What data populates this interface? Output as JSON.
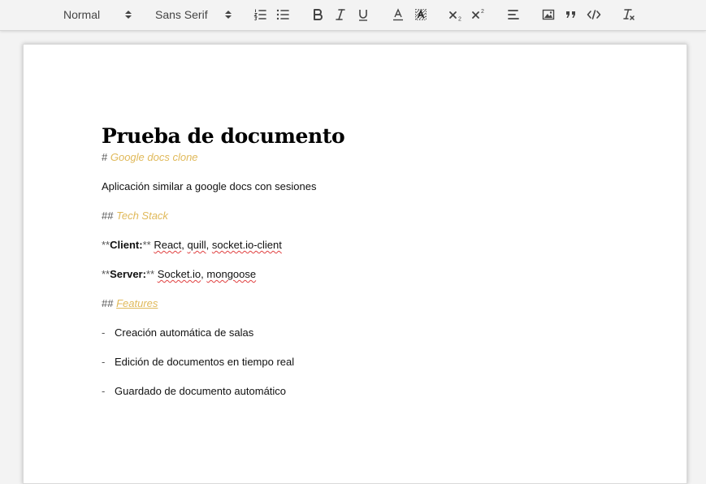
{
  "toolbar": {
    "header_select": "Normal",
    "font_select": "Sans Serif",
    "buttons": [
      {
        "name": "ordered-list-button",
        "icon": "ordered-list-icon"
      },
      {
        "name": "bullet-list-button",
        "icon": "bullet-list-icon"
      },
      {
        "name": "bold-button",
        "icon": "bold-icon"
      },
      {
        "name": "italic-button",
        "icon": "italic-icon"
      },
      {
        "name": "underline-button",
        "icon": "underline-icon"
      },
      {
        "name": "text-color-button",
        "icon": "text-color-icon"
      },
      {
        "name": "background-color-button",
        "icon": "highlight-icon"
      },
      {
        "name": "subscript-button",
        "icon": "subscript-icon"
      },
      {
        "name": "superscript-button",
        "icon": "superscript-icon"
      },
      {
        "name": "align-button",
        "icon": "align-left-icon"
      },
      {
        "name": "image-button",
        "icon": "image-icon"
      },
      {
        "name": "blockquote-button",
        "icon": "quote-icon"
      },
      {
        "name": "code-block-button",
        "icon": "code-icon"
      },
      {
        "name": "clear-format-button",
        "icon": "clear-format-icon"
      }
    ]
  },
  "document": {
    "title": "Prueba de documento",
    "heading1": {
      "marker": "#",
      "text": "Google docs clone"
    },
    "intro": "Aplicación similar a google docs con sesiones",
    "heading2_stack": {
      "marker": "##",
      "text": "Tech Stack"
    },
    "client": {
      "md_open": "**",
      "label": "Client:",
      "md_close": "**",
      "items": [
        {
          "text": "React",
          "spell": true
        },
        {
          "text": ", ",
          "spell": false
        },
        {
          "text": "quill",
          "spell": true
        },
        {
          "text": ", ",
          "spell": false
        },
        {
          "text": "socket.io-client",
          "spell": true
        }
      ]
    },
    "server": {
      "md_open": "**",
      "label": "Server:",
      "md_close": "**",
      "items": [
        {
          "text": "Socket.io",
          "spell": true
        },
        {
          "text": ", ",
          "spell": false
        },
        {
          "text": "mongoose",
          "spell": true
        }
      ]
    },
    "heading2_features": {
      "marker": "##",
      "text": "Features"
    },
    "features": [
      {
        "dash": "-",
        "text": "Creación automática de salas"
      },
      {
        "dash": "-",
        "text": "Edición de documentos en tiempo real"
      },
      {
        "dash": "-",
        "text": "Guardado de documento automático"
      }
    ]
  },
  "colors": {
    "heading_accent": "#e0b95a",
    "spellcheck_underline": "#e04040",
    "toolbar_bg": "#f3f3f3",
    "icon": "#444444"
  }
}
